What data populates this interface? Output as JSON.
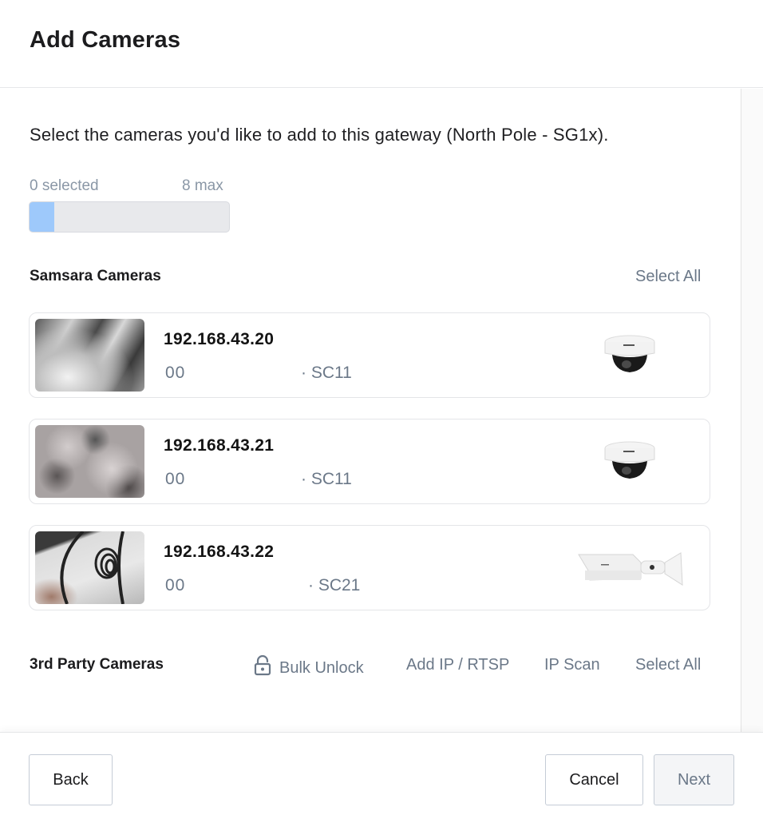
{
  "dialog": {
    "title": "Add Cameras",
    "intro": "Select the cameras you'd like to add to this gateway (North Pole - SG1x).",
    "selection": {
      "selected_label": "0 selected",
      "max_label": "8 max",
      "selected": 0,
      "max": 8
    }
  },
  "samsara_section": {
    "title": "Samsara Cameras",
    "select_all": "Select All",
    "cameras": [
      {
        "ip": "192.168.43.20",
        "serial": "00",
        "model": "· SC11",
        "type": "dome"
      },
      {
        "ip": "192.168.43.21",
        "serial": "00",
        "model": "· SC11",
        "type": "dome"
      },
      {
        "ip": "192.168.43.22",
        "serial": "00",
        "model": "· SC21",
        "type": "bullet"
      }
    ]
  },
  "third_party_section": {
    "title": "3rd Party Cameras",
    "actions": {
      "bulk_unlock": "Bulk Unlock",
      "add_ip": "Add IP / RTSP",
      "ip_scan": "IP Scan",
      "select_all": "Select All"
    }
  },
  "footer": {
    "back": "Back",
    "cancel": "Cancel",
    "next": "Next"
  },
  "colors": {
    "progress_fill": "#9ec9fb",
    "link": "#6b7888"
  }
}
